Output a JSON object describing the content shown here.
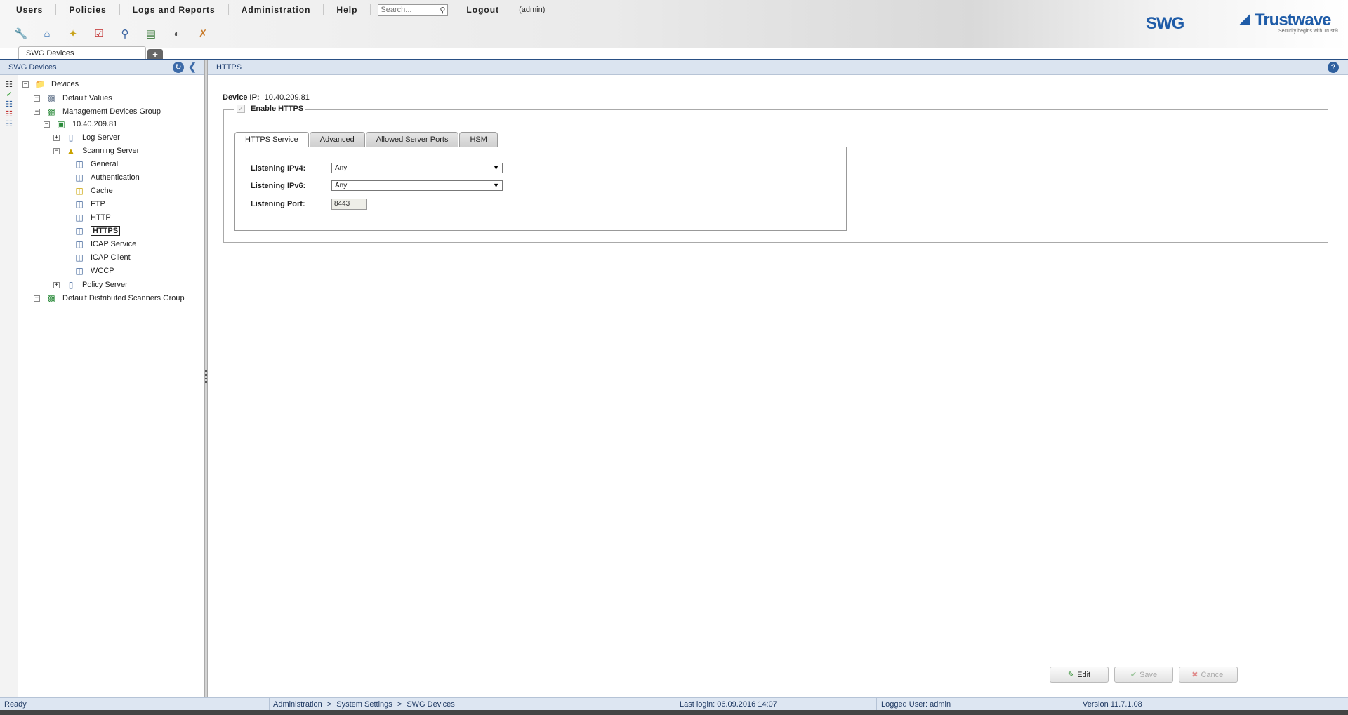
{
  "menu": {
    "items": [
      "Users",
      "Policies",
      "Logs and Reports",
      "Administration",
      "Help"
    ],
    "search_placeholder": "Search...",
    "logout": "Logout",
    "user": "(admin)"
  },
  "toolbar": {
    "icons": [
      "wrench-icon",
      "home-icon",
      "policy-wizard-icon",
      "checklist-icon",
      "search-devices-icon",
      "devices-icon",
      "dashboard-icon",
      "tools-icon"
    ]
  },
  "branding": {
    "product": "SWG",
    "company": "Trustwave",
    "tagline": "Security begins with Trust®",
    "brand_color": "#1f5ca8"
  },
  "tabs": {
    "document_tab": "SWG Devices",
    "add_tab": "+"
  },
  "left_panel": {
    "title": "SWG Devices",
    "tree": [
      {
        "label": "Devices",
        "expander": "−",
        "icon": "folder-icon"
      },
      {
        "label": "Default Values",
        "expander": "+",
        "icon": "default-values-icon"
      },
      {
        "label": "Management Devices Group",
        "expander": "−",
        "icon": "group-icon"
      },
      {
        "label": "10.40.209.81",
        "expander": "−",
        "icon": "device-icon"
      },
      {
        "label": "Log Server",
        "expander": "+",
        "icon": "server-icon"
      },
      {
        "label": "Scanning Server",
        "expander": "−",
        "icon": "scanning-server-icon"
      },
      {
        "label": "General",
        "icon": "module-icon"
      },
      {
        "label": "Authentication",
        "icon": "module-icon"
      },
      {
        "label": "Cache",
        "icon": "cache-icon"
      },
      {
        "label": "FTP",
        "icon": "module-icon"
      },
      {
        "label": "HTTP",
        "icon": "module-icon"
      },
      {
        "label": "HTTPS",
        "icon": "module-icon",
        "selected": true
      },
      {
        "label": "ICAP Service",
        "icon": "module-icon"
      },
      {
        "label": "ICAP Client",
        "icon": "module-icon"
      },
      {
        "label": "WCCP",
        "icon": "module-icon"
      },
      {
        "label": "Policy Server",
        "expander": "+",
        "icon": "server-icon"
      },
      {
        "label": "Default Distributed Scanners Group",
        "expander": "+",
        "icon": "group-icon"
      }
    ]
  },
  "right_panel": {
    "title": "HTTPS",
    "device_ip_label": "Device IP:",
    "device_ip": "10.40.209.81",
    "enable_https_label": "Enable HTTPS",
    "enable_https_checked": true,
    "tabs": [
      "HTTPS Service",
      "Advanced",
      "Allowed Server Ports",
      "HSM"
    ],
    "active_tab": "HTTPS Service",
    "fields": {
      "ipv4_label": "Listening IPv4:",
      "ipv4_value": "Any",
      "ipv6_label": "Listening IPv6:",
      "ipv6_value": "Any",
      "port_label": "Listening Port:",
      "port_value": "8443"
    },
    "buttons": {
      "edit": "Edit",
      "save": "Save",
      "cancel": "Cancel"
    }
  },
  "status_bar": {
    "state": "Ready",
    "breadcrumb": [
      "Administration",
      "System Settings",
      "SWG Devices"
    ],
    "breadcrumb_sep": ">",
    "last_login": "Last login: 06.09.2016 14:07",
    "logged_user": "Logged User: admin",
    "version": "Version 11.7.1.08"
  }
}
